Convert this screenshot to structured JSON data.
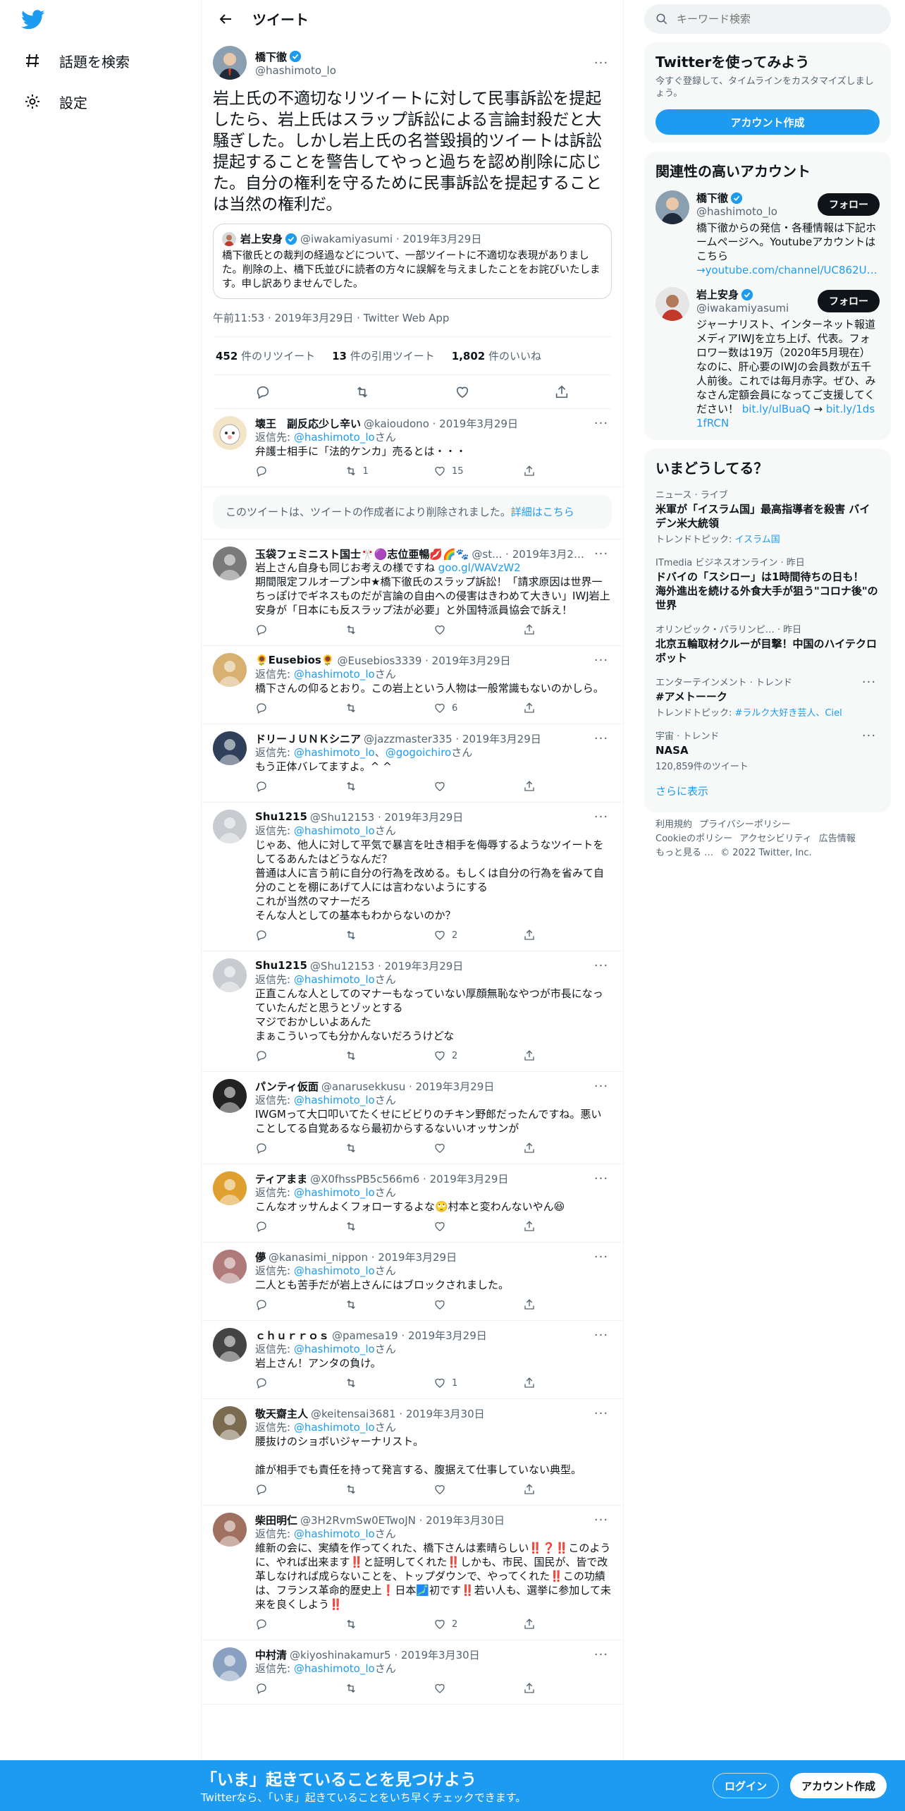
{
  "nav": {
    "explore": "話題を検索",
    "settings": "設定"
  },
  "header": {
    "title": "ツイート"
  },
  "main_tweet": {
    "name": "橋下徹",
    "handle": "@hashimoto_lo",
    "text": "岩上氏の不適切なリツイートに対して民事訴訟を提起したら、岩上氏はスラップ訴訟による言論封殺だと大騒ぎした。しかし岩上氏の名誉毀損的ツイートは訴訟提起することを警告してやっと過ちを認め削除に応じた。自分の権利を守るために民事訴訟を提起することは当然の権利だ。",
    "quote": {
      "name": "岩上安身",
      "meta": "@iwakamiyasumi · 2019年3月29日",
      "text": "橋下徹氏との裁判の経過などについて、一部ツイートに不適切な表現がありました。削除の上、橋下氏並びに読者の方々に誤解を与えましたことをお詫びいたします。申し訳ありませんでした。"
    },
    "time": "午前11:53 · 2019年3月29日 · Twitter Web App",
    "retweets": "452",
    "retweets_label": "件のリツイート",
    "quotes": "13",
    "quotes_label": "件の引用ツイート",
    "likes": "1,802",
    "likes_label": "件のいいね"
  },
  "replies": [
    {
      "name": "壊王　副反応少し辛い",
      "meta": "@kaioudono · 2019年3月29日",
      "replying_prefix": "返信先: ",
      "replying_to": "@hashimoto_lo",
      "replying_suffix": "さん",
      "text": "弁護士相手に「法的ケンカ」売るとは・・・",
      "retweets": "1",
      "likes": "15"
    }
  ],
  "deleted": {
    "text": "このツイートは、ツイートの作成者により削除されました。",
    "link": "詳細はこちら"
  },
  "replies2": [
    {
      "name": "玉袋フェミニスト国士🎌🟣志位亜暢💋🌈🐾",
      "meta": "@st... · 2019年3月29日",
      "link": "goo.gl/WAVzW2",
      "text_pre": "岩上さん自身も同じお考えの様ですね ",
      "text": "期間限定フルオープン中★橋下徹氏のスラップ訴訟！「請求原因は世界一ちっぽけでギネスものだが言論の自由への侵害はきわめて大きい」IWJ岩上安身が「日本にも反スラップ法が必要」と外国特派員協会で訴え！",
      "retweets": "",
      "likes": ""
    },
    {
      "name": "🌻Eusebios🌻",
      "meta": "@Eusebios3339 · 2019年3月29日",
      "replying_to": "@hashimoto_lo",
      "text": "橋下さんの仰るとおり。この岩上という人物は一般常識もないのかしら。",
      "retweets": "",
      "likes": "6"
    },
    {
      "name": "ドリーＪＵＮＫシニア",
      "meta": "@jazzmaster335 · 2019年3月29日",
      "replying_to": "@hashimoto_lo",
      "replying_to2": "@gogoichiro",
      "text": "もう正体バレてますよ。^ ^",
      "retweets": "",
      "likes": ""
    },
    {
      "name": "Shu1215",
      "meta": "@Shu12153 · 2019年3月29日",
      "replying_to": "@hashimoto_lo",
      "text": "じゃあ、他人に対して平気で暴言を吐き相手を侮辱するようなツイートをしてるあんたはどうなんだ？\n普通は人に言う前に自分の行為を改める。もしくは自分の行為を省みて自分のことを棚にあげて人には言わないようにする\nこれが当然のマナーだろ\nそんな人としての基本もわからないのか？",
      "retweets": "",
      "likes": "2"
    },
    {
      "name": "Shu1215",
      "meta": "@Shu12153 · 2019年3月29日",
      "replying_to": "@hashimoto_lo",
      "text": "正直こんな人としてのマナーもなっていない厚顔無恥なやつが市長になっていたんだと思うとゾッとする\nマジでおかしいよあんた\nまぁこういっても分かんないだろうけどな",
      "retweets": "",
      "likes": "2"
    },
    {
      "name": "パンティ仮面",
      "meta": "@anarusekkusu · 2019年3月29日",
      "replying_to": "@hashimoto_lo",
      "text": "IWGMって大口叩いてたくせにビビりのチキン野郎だったんですね。悪いことしてる自覚あるなら最初からするないいオッサンが",
      "retweets": "",
      "likes": ""
    },
    {
      "name": "ティアまま",
      "meta": "@X0fhssPB5c566m6 · 2019年3月29日",
      "replying_to": "@hashimoto_lo",
      "text": "こんなオッサんよくフォローするよな🙄村本と変わんないやん😆",
      "retweets": "",
      "likes": ""
    },
    {
      "name": "儚",
      "meta": "@kanasimi_nippon · 2019年3月29日",
      "replying_to": "@hashimoto_lo",
      "text": "二人とも苦手だが岩上さんにはブロックされました。",
      "retweets": "",
      "likes": ""
    },
    {
      "name": "ｃｈｕｒｒｏｓ",
      "meta": "@pamesa19 · 2019年3月29日",
      "replying_to": "@hashimoto_lo",
      "text": "岩上さん！アンタの負け。",
      "retweets": "",
      "likes": "1"
    },
    {
      "name": "敬天齋主人",
      "meta": "@keitensai3681 · 2019年3月30日",
      "replying_to": "@hashimoto_lo",
      "text": "腰抜けのショボいジャーナリスト。\n\n誰が相手でも責任を持って発言する、腹据えて仕事していない典型。",
      "retweets": "",
      "likes": ""
    },
    {
      "name": "柴田明仁",
      "meta": "@3H2RvmSw0ETwoJN · 2019年3月30日",
      "replying_to": "@hashimoto_lo",
      "text": "維新の会に、実績を作ってくれた、橋下さんは素晴らしい‼️❓‼️このように、やれば出来ます‼️と証明してくれた‼️しかも、市民、国民が、皆で改革しなければ成らないことを、トップダウンで、やってくれた‼️この功績は、フランス革命的歴史上❗日本🗾初です‼️若い人も、選挙に参加して未来を良くしよう‼️",
      "retweets": "",
      "likes": "2"
    },
    {
      "name": "中村清",
      "meta": "@kiyoshinakamur5 · 2019年3月30日",
      "replying_to": "@hashimoto_lo",
      "text": "",
      "retweets": "",
      "likes": ""
    }
  ],
  "right": {
    "search_placeholder": "キーワード検索",
    "signup_box": {
      "title": "Twitterを使ってみよう",
      "sub": "今すぐ登録して、タイムラインをカスタマイズしましょう。",
      "button": "アカウント作成"
    },
    "related": {
      "title": "関連性の高いアカウント",
      "accounts": [
        {
          "name": "橋下徹",
          "handle": "@hashimoto_lo",
          "follow": "フォロー",
          "bio": "橋下徹からの発信・各種情報は下記ホームページへ。Youtubeアカウントはこちら",
          "bio_link": "→youtube.com/channel/UC862U…"
        },
        {
          "name": "岩上安身",
          "handle": "@iwakamiyasumi",
          "follow": "フォロー",
          "bio": "ジャーナリスト、インターネット報道メディアIWJを立ち上げ、代表。フォロワー数は19万（2020年5月現在）なのに、肝心要のIWJの会員数が五千人前後。これでは毎月赤字。ぜひ、みなさん定額会員になってご支援してください！ ",
          "bio_link": "bit.ly/ulBuaQ",
          "bio_link2": "bit.ly/1ds1fRCN"
        }
      ]
    },
    "trends": {
      "title": "いまどうしてる？",
      "items": [
        {
          "meta": "ニュース · ライブ",
          "title": "米軍が「イスラム国」最高指導者を殺害 バイデン米大統領",
          "sub_prefix": "トレンドトピック: ",
          "sub_link": "イスラム国"
        },
        {
          "meta": "ITmedia ビジネスオンライン · 昨日",
          "title": "ドバイの「スシロー」は1時間待ちの日も！　海外進出を続ける外食大手が狙う\"コロナ後\"の世界",
          "sub_prefix": "",
          "sub_link": ""
        },
        {
          "meta": "オリンピック・パラリンピ… · 昨日",
          "title": "北京五輪取材クルーが目撃！中国のハイテクロボット",
          "sub_prefix": "",
          "sub_link": ""
        },
        {
          "meta": "エンターテインメント · トレンド",
          "title": "#アメトーーク",
          "sub_prefix": "トレンドトピック: ",
          "sub_link": "#ラルク大好き芸人、Ciel"
        },
        {
          "meta": "宇宙 · トレンド",
          "title": "NASA",
          "sub_prefix": "120,859件のツイート",
          "sub_link": ""
        }
      ],
      "show_more": "さらに表示"
    },
    "footer": {
      "line1": [
        "利用規約",
        "プライバシーポリシー"
      ],
      "line2": [
        "Cookieのポリシー",
        "アクセシビリティ",
        "広告情報"
      ],
      "line3": [
        "もっと見る …",
        "© 2022 Twitter, Inc."
      ]
    }
  },
  "bottom_bar": {
    "title": "「いま」起きていることを見つけよう",
    "sub": "Twitterなら、「いま」起きていることをいち早くチェックできます。",
    "login": "ログイン",
    "signup": "アカウント作成"
  },
  "colors": {
    "accent": "#1d9bf0",
    "text": "#0f1419",
    "muted": "#536471"
  }
}
